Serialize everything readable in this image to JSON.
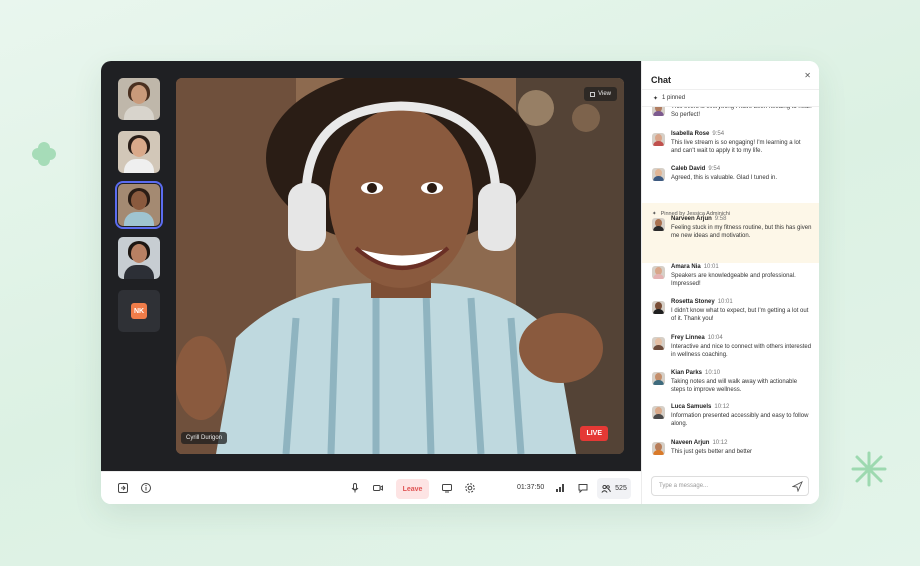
{
  "window": {
    "participants": [
      {
        "name": "participant-1",
        "skin": "#c99a7a",
        "hair": "#4a3020",
        "shirt": "#d8d4cc",
        "bg": "#bfb7aa"
      },
      {
        "name": "participant-2",
        "skin": "#d9a98a",
        "hair": "#2a1e18",
        "shirt": "#efefef",
        "bg": "#d2c7b8"
      },
      {
        "name": "participant-3",
        "skin": "#8a5a3e",
        "hair": "#2a1d15",
        "shirt": "#9fc4d0",
        "bg": "#a48a72",
        "active": true
      },
      {
        "name": "participant-4",
        "skin": "#b88063",
        "hair": "#1d1612",
        "shirt": "#2c2f36",
        "bg": "#c7cdd2"
      },
      {
        "name": "participant-5",
        "initials": "NK"
      }
    ]
  },
  "video": {
    "view_label": "View",
    "speaker_name": "Cyrill Durigon",
    "live_label": "LIVE"
  },
  "controls": {
    "leave_label": "Leave",
    "timer": "01:37:50",
    "people_count": "525"
  },
  "chat": {
    "title": "Chat",
    "pinned_count": "1 pinned",
    "pinned_by": "Pinned by Jessica Adminichi",
    "input_placeholder": "Type a message...",
    "messages": [
      {
        "name": "",
        "time": "",
        "text": "This event is everything I have been needing to hear. So perfect!",
        "skin": "#b07c60",
        "shirt": "#7d5a8f"
      },
      {
        "name": "Isabella Rose",
        "time": "9:54",
        "text": "This live stream is so engaging! I'm learning a lot and can't wait to apply it to my life.",
        "skin": "#d9a58a",
        "shirt": "#c0504d"
      },
      {
        "name": "Caleb David",
        "time": "9:54",
        "text": "Agreed, this is valuable. Glad I tuned in.",
        "skin": "#e0b595",
        "shirt": "#3d5a80"
      },
      {
        "name": "Narveen Arjun",
        "time": "9:58",
        "text": "Feeling stuck in my fitness routine, but this has given me new ideas and motivation.",
        "skin": "#a8704e",
        "shirt": "#2a2a2a"
      },
      {
        "name": "Amara Nia",
        "time": "10:01",
        "text": "Speakers are knowledgeable and professional. Impressed!",
        "skin": "#d8a68a",
        "shirt": "#e4b2b2"
      },
      {
        "name": "Rosetta Stoney",
        "time": "10:01",
        "text": "I didn't know what to expect, but I'm getting a lot out of it. Thank you!",
        "skin": "#7a4e36",
        "shirt": "#1f1f1f"
      },
      {
        "name": "Frey Linnea",
        "time": "10:04",
        "text": "Interactive and nice to connect with others interested in wellness coaching.",
        "skin": "#e4bfa4",
        "shirt": "#6d4b3a"
      },
      {
        "name": "Kian Parks",
        "time": "10:10",
        "text": "Taking notes and will walk away with actionable steps to improve wellness.",
        "skin": "#c48e6b",
        "shirt": "#3f6b7d"
      },
      {
        "name": "Luca Samuels",
        "time": "10:12",
        "text": "Information presented accessibly and easy to follow along.",
        "skin": "#d9a98a",
        "shirt": "#4a4a4a"
      },
      {
        "name": "Naveen Arjun",
        "time": "10:12",
        "text": "This just gets better and better",
        "skin": "#b77d59",
        "shirt": "#d97a2a"
      }
    ]
  },
  "colors": {
    "accent": "#5b6cf0",
    "live": "#e53935",
    "leave_bg": "#fde4e4",
    "leave_text": "#e05454",
    "pinned_bg": "#fdf7e8",
    "decor_green": "#9dd9b0"
  }
}
